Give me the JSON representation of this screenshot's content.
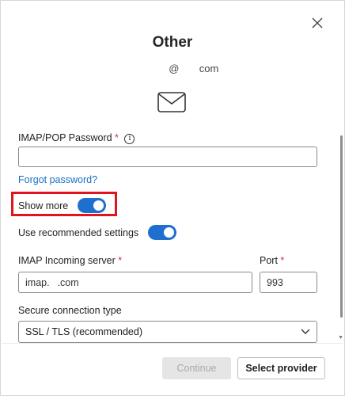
{
  "dialog": {
    "title": "Other",
    "email_at": "@",
    "email_domain": "com"
  },
  "password": {
    "label": "IMAP/POP Password",
    "required_mark": "*",
    "info_glyph": "i",
    "value": "",
    "forgot_link": "Forgot password?"
  },
  "toggles": {
    "show_more_label": "Show more",
    "show_more_on": true,
    "recommended_label": "Use recommended settings",
    "recommended_on": true
  },
  "server": {
    "label": "IMAP Incoming server",
    "required_mark": "*",
    "value_prefix": "imap.",
    "value_suffix": ".com",
    "port_label": "Port",
    "port_required_mark": "*",
    "port_value": "993"
  },
  "security": {
    "label": "Secure connection type",
    "selected": "SSL / TLS (recommended)"
  },
  "buttons": {
    "continue": "Continue",
    "select_provider": "Select provider"
  },
  "colors": {
    "accent": "#1e6fd0",
    "link": "#1a6fc4",
    "highlight": "#e0141e",
    "required": "#c4314b"
  }
}
